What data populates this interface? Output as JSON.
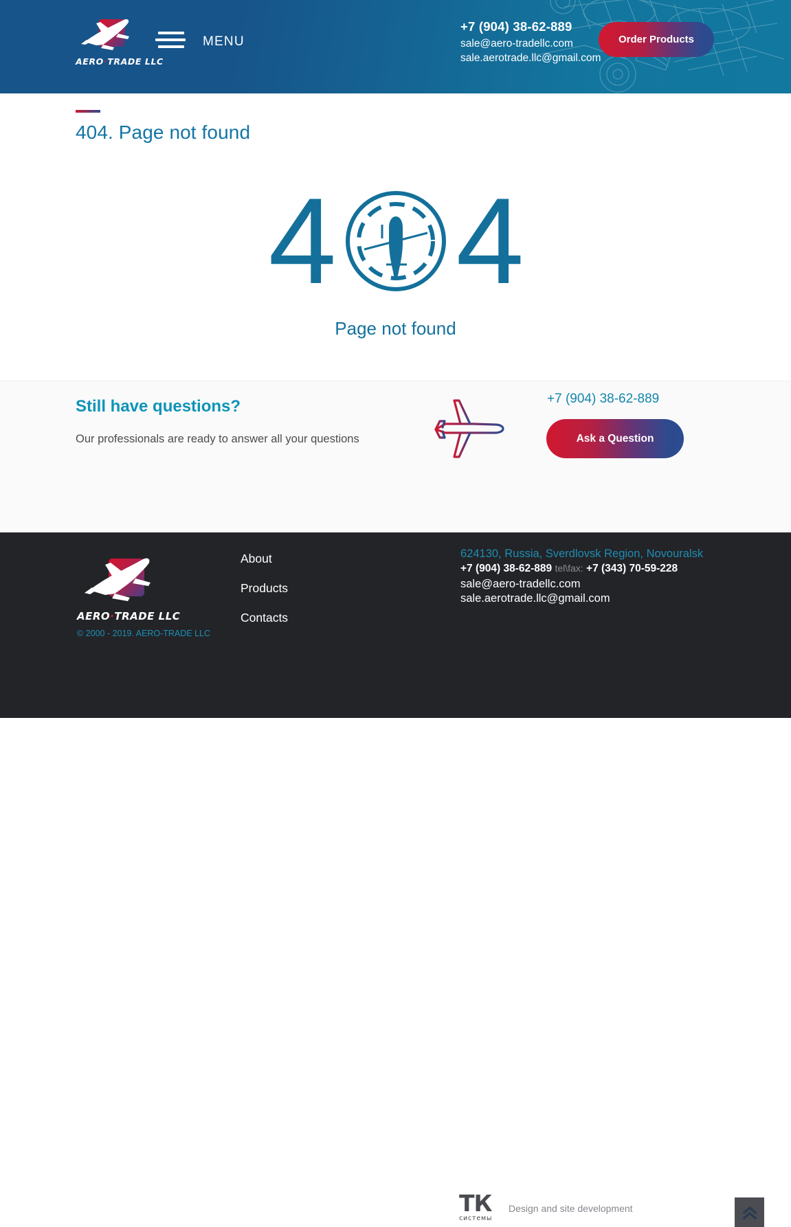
{
  "header": {
    "logo": {
      "name": "aero-trade-logo",
      "word_pre": "AERO",
      "word_dot": "·",
      "word_post": "TRADE LLC"
    },
    "menu_label": "MENU",
    "phone": "+7 (904) 38-62-889",
    "email1": "sale@aero-tradellc.com",
    "email2": "sale.aerotrade.llc@gmail.com",
    "order_button": "Order Products"
  },
  "page": {
    "title": "404. Page not found"
  },
  "error": {
    "digit_left": "4",
    "digit_right": "4",
    "subtitle": "Page not found"
  },
  "questions": {
    "title": "Still have questions?",
    "subtitle": "Our professionals are ready to answer all your questions",
    "phone": "+7 (904) 38-62-889",
    "ask_button": "Ask a Question"
  },
  "footer": {
    "logo": {
      "word_pre": "AERO",
      "word_dot": "·",
      "word_post": "TRADE LLC"
    },
    "copyright": "© 2000 - 2019. AERO-TRADE LLC",
    "nav": [
      {
        "label": "About"
      },
      {
        "label": "Products"
      },
      {
        "label": "Contacts"
      }
    ],
    "address": "624130, Russia, Sverdlovsk Region, Novouralsk",
    "phone_main": "+7 (904) 38-62-889",
    "telfax_label": "tel\\fax:",
    "phone_fax": "+7 (343) 70-59-228",
    "email1": "sale@aero-tradellc.com",
    "email2": "sale.aerotrade.llc@gmail.com",
    "developer": {
      "logo_main": "ТК",
      "logo_sub": "системы",
      "text": "Design and site development"
    }
  },
  "colors": {
    "header_navy": "#17548a",
    "header_teal": "#12789f",
    "brand_red": "#d2182f",
    "brand_blue": "#2b4b91",
    "link_blue": "#1275a6",
    "footer_bg": "#232428",
    "accent_teal": "#0f93b8"
  }
}
